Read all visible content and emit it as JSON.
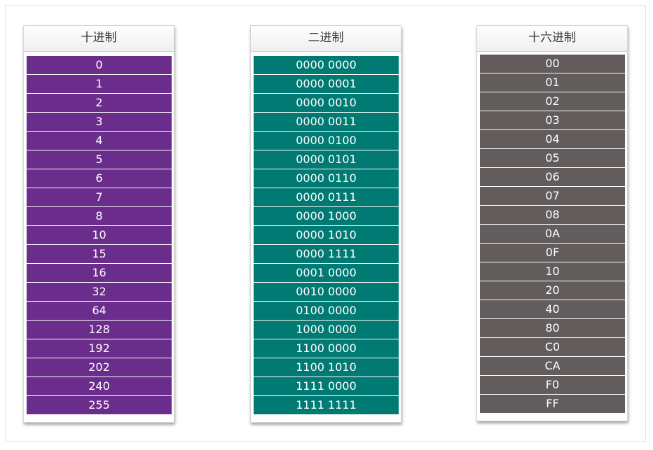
{
  "columns": [
    {
      "id": "decimal",
      "header": "十进制",
      "color": "#6a2d8b",
      "values": [
        "0",
        "1",
        "2",
        "3",
        "4",
        "5",
        "6",
        "7",
        "8",
        "10",
        "15",
        "16",
        "32",
        "64",
        "128",
        "192",
        "202",
        "240",
        "255"
      ]
    },
    {
      "id": "binary",
      "header": "二进制",
      "color": "#007a72",
      "values": [
        "0000 0000",
        "0000 0001",
        "0000 0010",
        "0000 0011",
        "0000 0100",
        "0000 0101",
        "0000 0110",
        "0000 0111",
        "0000 1000",
        "0000 1010",
        "0000 1111",
        "0001 0000",
        "0010 0000",
        "0100 0000",
        "1000 0000",
        "1100 0000",
        "1100 1010",
        "1111 0000",
        "1111 1111"
      ]
    },
    {
      "id": "hexadecimal",
      "header": "十六进制",
      "color": "#625c5c",
      "values": [
        "00",
        "01",
        "02",
        "03",
        "04",
        "05",
        "06",
        "07",
        "08",
        "0A",
        "0F",
        "10",
        "20",
        "40",
        "80",
        "C0",
        "CA",
        "F0",
        "FF"
      ]
    }
  ]
}
